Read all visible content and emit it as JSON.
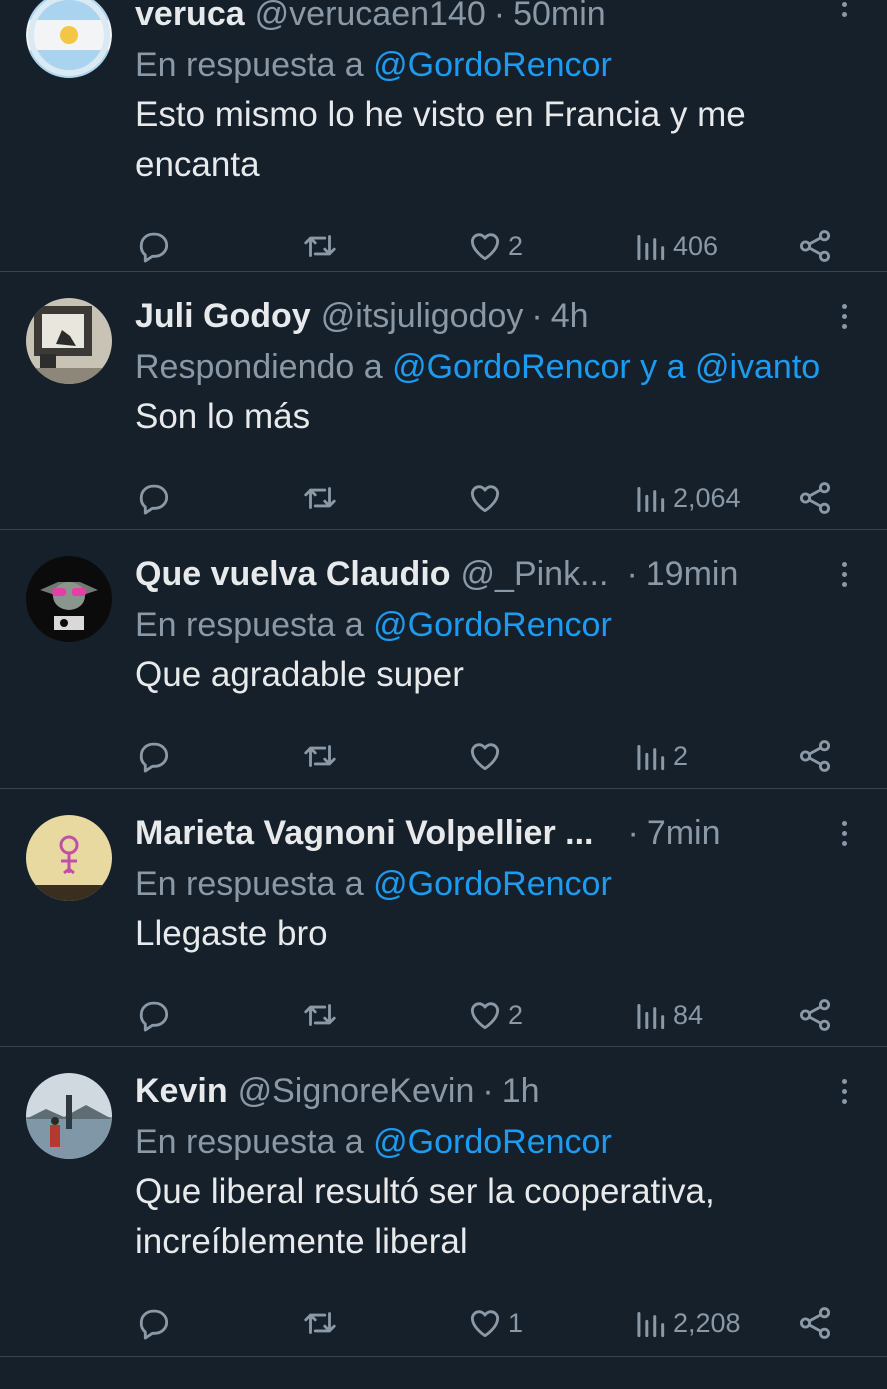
{
  "replies": [
    {
      "name": "veruca",
      "handle": "@verucaen140",
      "time": "50min",
      "context_prefix": "En respuesta a ",
      "context_mention": "@GordoRencor",
      "text": "Esto mismo lo he visto en Francia y me encanta",
      "likes": "2",
      "views": "406",
      "avatar_icon": "argentina-flag-sun"
    },
    {
      "name": "Juli Godoy",
      "handle": "@itsjuligodoy",
      "time": "4h",
      "context_prefix": "Respondiendo a ",
      "context_mention": "@GordoRencor y a @ivanto",
      "text": "Son lo más",
      "likes": "",
      "views": "2,064",
      "avatar_icon": "photo-street-art"
    },
    {
      "name": "Que vuelva Claudio",
      "handle": "@_Pink...",
      "time": "19min",
      "context_prefix": "En respuesta a ",
      "context_mention": "@GordoRencor",
      "text": "Que agradable super",
      "likes": "",
      "views": "2",
      "avatar_icon": "yoda-pink-glasses"
    },
    {
      "name": "Marieta Vagnoni Volpellier ...",
      "handle": "",
      "time": "7min",
      "context_prefix": "En respuesta a ",
      "context_mention": "@GordoRencor",
      "text": "Llegaste bro",
      "likes": "2",
      "views": "84",
      "avatar_icon": "prince-symbol"
    },
    {
      "name": "Kevin",
      "handle": "@SignoreKevin",
      "time": "1h",
      "context_prefix": "En respuesta a ",
      "context_mention": "@GordoRencor",
      "text": "Que liberal resultó ser la cooperativa, increíblemente liberal",
      "likes": "1",
      "views": "2,208",
      "avatar_icon": "photo-lake"
    }
  ],
  "dot": "·",
  "colors": {
    "background": "#15202b",
    "accent": "#1d9bf0",
    "muted": "#8b98a5",
    "divider": "#38444d"
  }
}
